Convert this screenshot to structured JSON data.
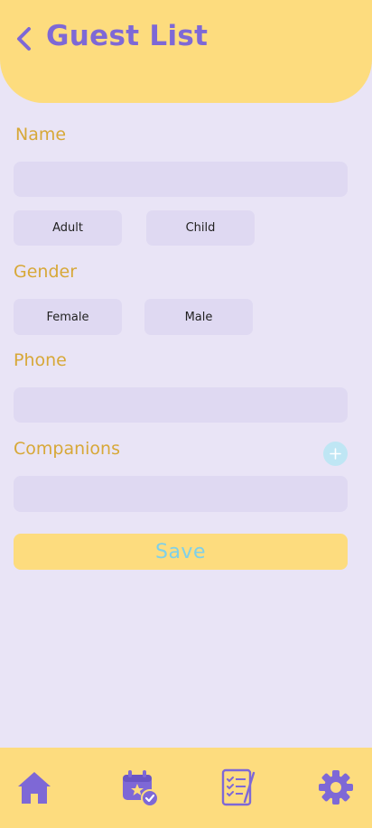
{
  "header": {
    "title": "Guest List",
    "back_icon": "chevron-left-icon"
  },
  "form": {
    "name_label": "Name",
    "name_value": "",
    "age_options": [
      "Adult",
      "Child"
    ],
    "gender_label": "Gender",
    "gender_options": [
      "Female",
      "Male"
    ],
    "phone_label": "Phone",
    "phone_value": "",
    "companions_label": "Companions",
    "companions_value": "",
    "add_companion_icon": "plus-icon",
    "save_label": "Save"
  },
  "bottom_nav": {
    "items": [
      {
        "icon": "home-icon"
      },
      {
        "icon": "event-check-icon"
      },
      {
        "icon": "checklist-icon"
      },
      {
        "icon": "gear-icon"
      }
    ]
  },
  "colors": {
    "background": "#E9E4F6",
    "header": "#FDDC7E",
    "accent_purple": "#7E68D6",
    "label_gold": "#D7A838",
    "field": "#DFD9F2",
    "save_text": "#7FD0E8",
    "add_button": "#BFE6F4"
  }
}
